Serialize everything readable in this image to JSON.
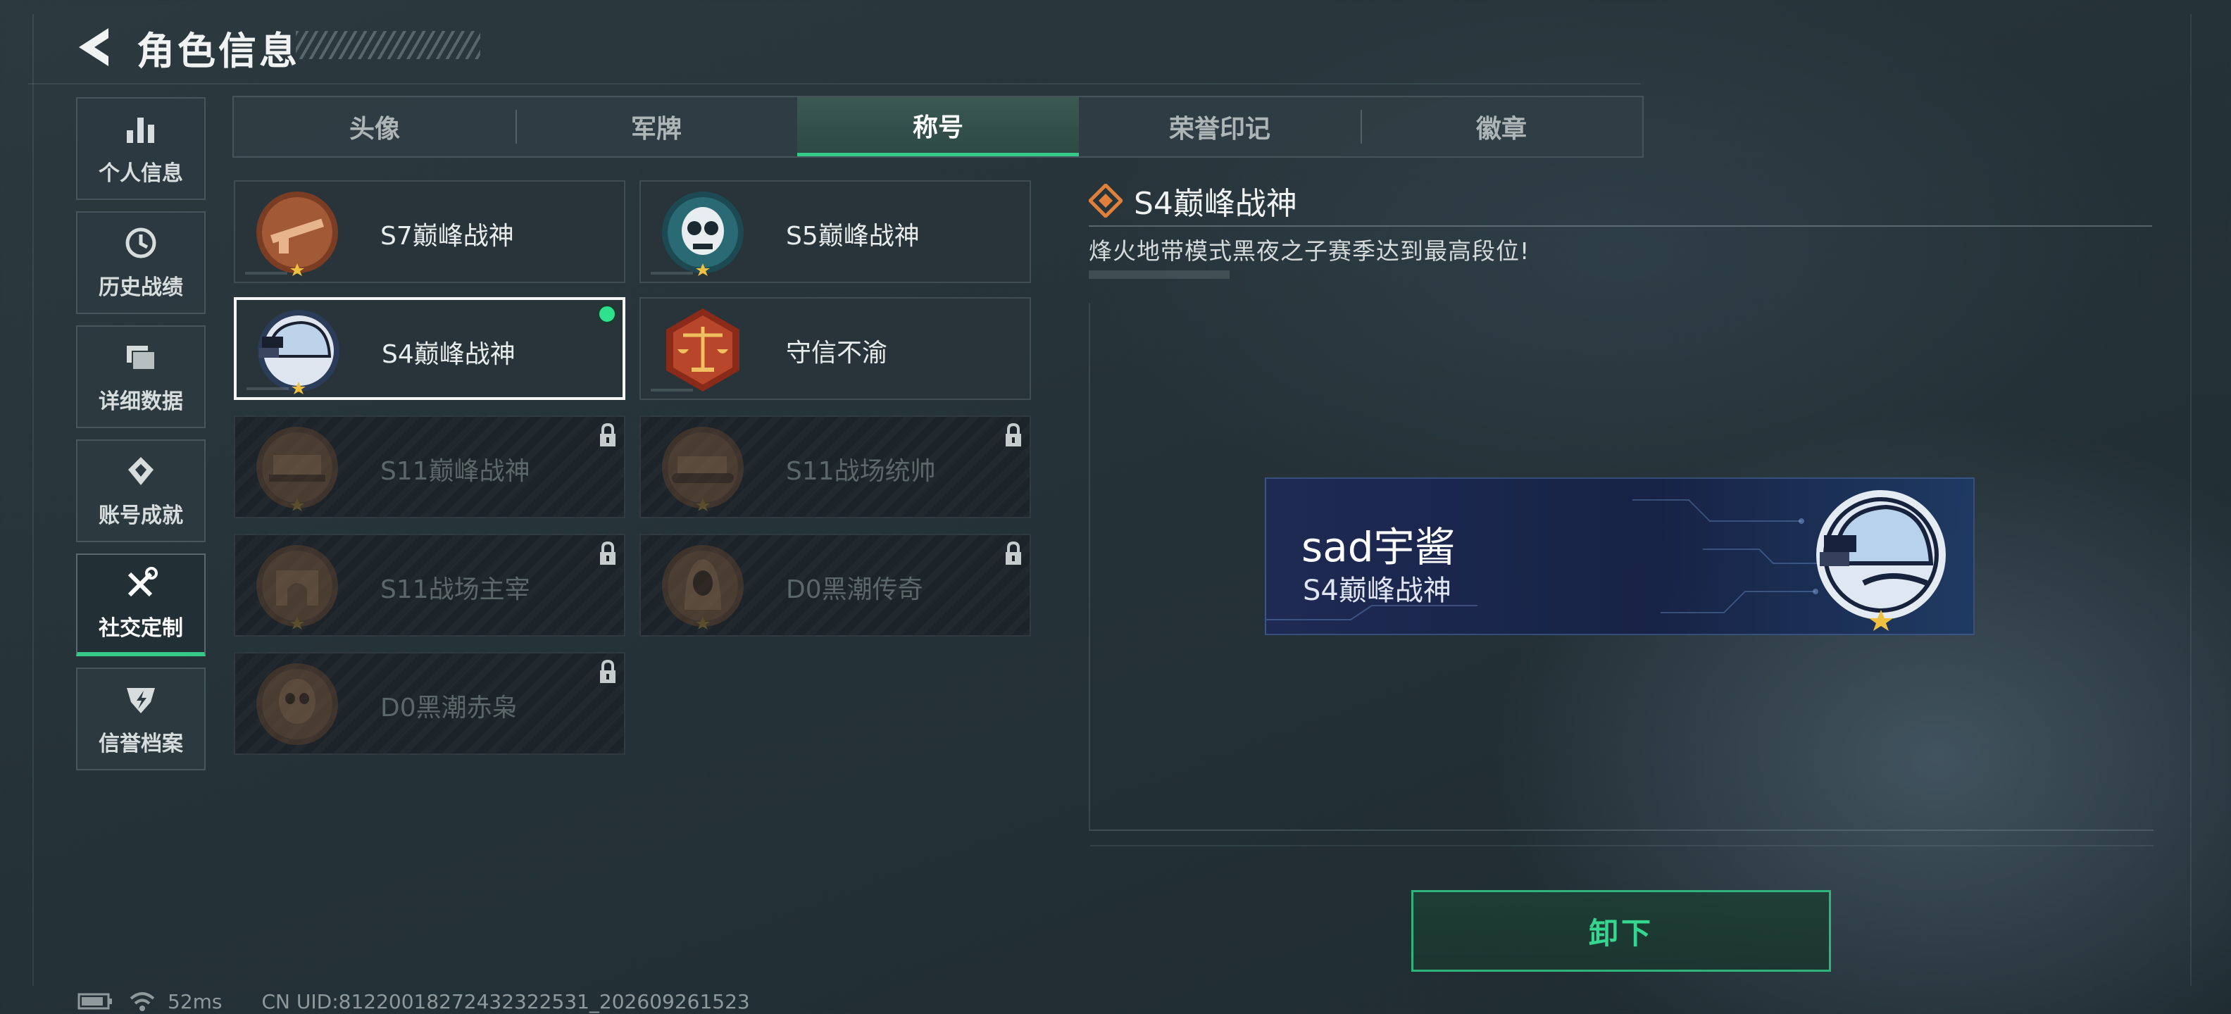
{
  "header": {
    "title": "角色信息"
  },
  "sidebar": {
    "items": [
      {
        "label": "个人信息",
        "icon": "bar-chart-icon"
      },
      {
        "label": "历史战绩",
        "icon": "history-clock-icon"
      },
      {
        "label": "详细数据",
        "icon": "data-cards-icon"
      },
      {
        "label": "账号成就",
        "icon": "achievement-icon"
      },
      {
        "label": "社交定制",
        "icon": "tools-icon",
        "active": true
      },
      {
        "label": "信誉档案",
        "icon": "reputation-shield-icon"
      }
    ]
  },
  "tabs": [
    {
      "label": "头像"
    },
    {
      "label": "军牌"
    },
    {
      "label": "称号",
      "active": true
    },
    {
      "label": "荣誉印记"
    },
    {
      "label": "徽章"
    }
  ],
  "titles": [
    {
      "name": "S7巅峰战神",
      "locked": false
    },
    {
      "name": "S5巅峰战神",
      "locked": false
    },
    {
      "name": "S4巅峰战神",
      "locked": false,
      "selected": true,
      "equipped": true
    },
    {
      "name": "守信不渝",
      "locked": false
    },
    {
      "name": "S11巅峰战神",
      "locked": true
    },
    {
      "name": "S11战场统帅",
      "locked": true
    },
    {
      "name": "S11战场主宰",
      "locked": true
    },
    {
      "name": "D0黑潮传奇",
      "locked": true
    },
    {
      "name": "D0黑潮赤枭",
      "locked": true
    }
  ],
  "detail": {
    "title": "S4巅峰战神",
    "description": "烽火地带模式黑夜之子赛季达到最高段位!"
  },
  "nameplate": {
    "player_name": "sad宇酱",
    "title": "S4巅峰战神"
  },
  "actions": {
    "unequip_label": "卸下"
  },
  "status": {
    "ping": "52ms",
    "uid": "CN UID:81220018272432322531_202609261523"
  },
  "colors": {
    "accent_green": "#35c98a",
    "equipped_dot": "#2fe08d",
    "nameplate_blue": "#1e2a54",
    "medal_bronze": "#8a4a2a"
  }
}
